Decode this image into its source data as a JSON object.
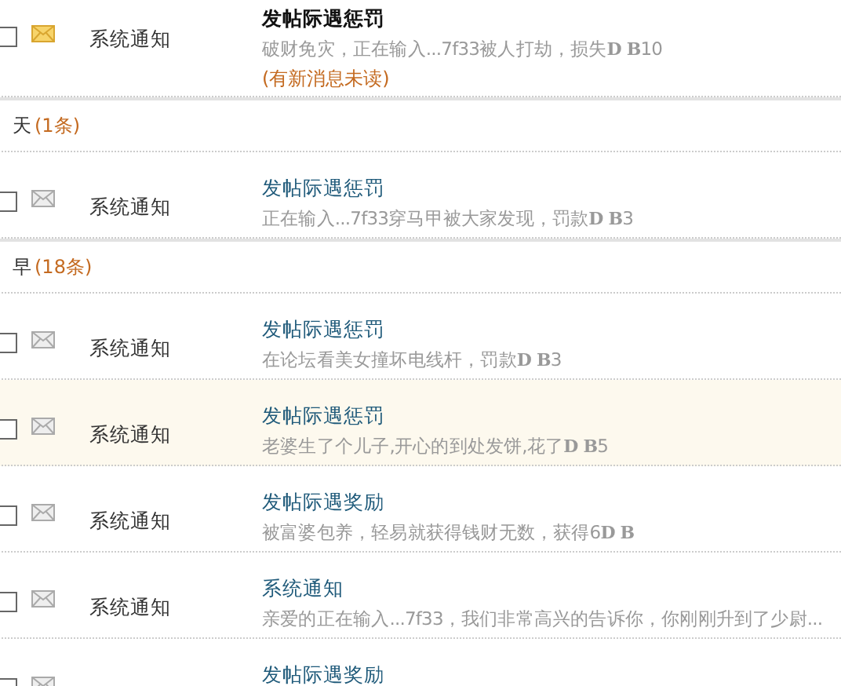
{
  "groups": [
    {
      "messages": [
        {
          "sender": "系统通知",
          "title": "发帖际遇惩罚",
          "summary": "破财免灾，正在输入...7f33被人打劫，损失**D B**10",
          "unread": true,
          "note": "(有新消息未读)",
          "checked": false,
          "highlighted": false
        }
      ]
    },
    {
      "label": "天",
      "count": "(1条)",
      "messages": [
        {
          "sender": "系统通知",
          "title": "发帖际遇惩罚",
          "summary": "正在输入...7f33穿马甲被大家发现，罚款**D B**3",
          "unread": false,
          "checked": false,
          "highlighted": false
        }
      ]
    },
    {
      "label": "早",
      "count": "(18条)",
      "messages": [
        {
          "sender": "系统通知",
          "title": "发帖际遇惩罚",
          "summary": "在论坛看美女撞坏电线杆，罚款**D B**3",
          "unread": false,
          "checked": false,
          "highlighted": false
        },
        {
          "sender": "系统通知",
          "title": "发帖际遇惩罚",
          "summary": "老婆生了个儿子,开心的到处发饼,花了**D B**5",
          "unread": false,
          "checked": false,
          "highlighted": true
        },
        {
          "sender": "系统通知",
          "title": "发帖际遇奖励",
          "summary": "被富婆包养，轻易就获得钱财无数，获得6**D B**",
          "unread": false,
          "checked": false,
          "highlighted": false
        },
        {
          "sender": "系统通知",
          "title": "系统通知",
          "summary": "亲爱的正在输入...7f33，我们非常高兴的告诉你，你刚刚升到了少尉...",
          "unread": false,
          "checked": false,
          "highlighted": false
        },
        {
          "title": "发帖际遇奖励",
          "unread": false,
          "checked": false,
          "highlighted": false
        }
      ]
    }
  ]
}
